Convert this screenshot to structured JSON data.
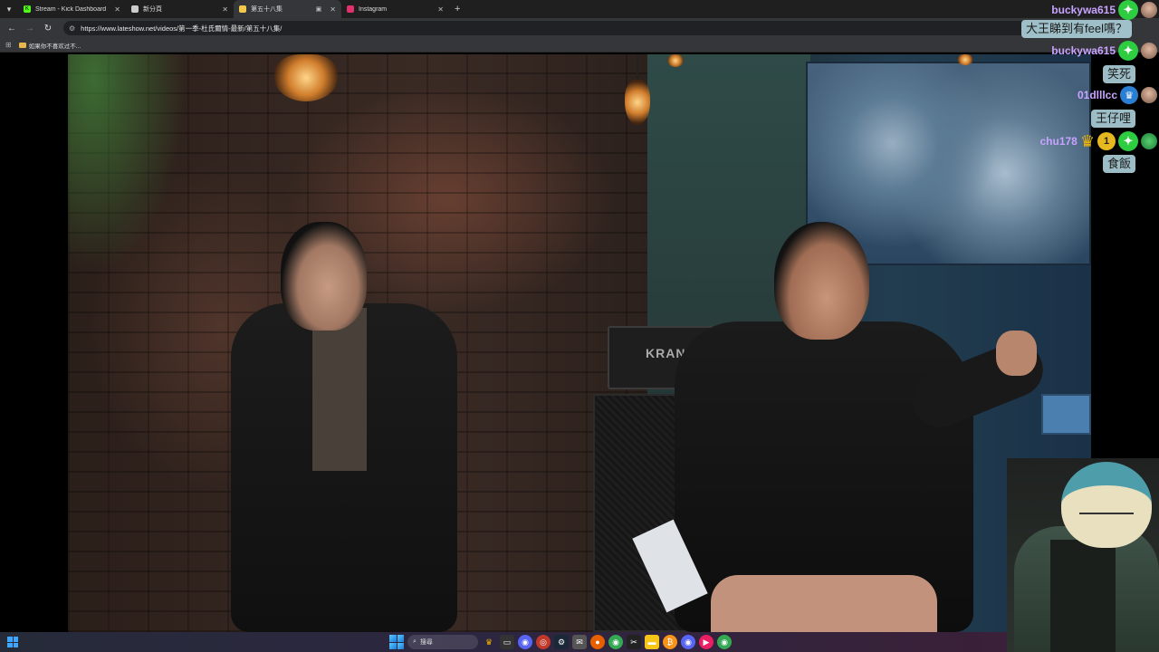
{
  "browser": {
    "tabs": [
      {
        "title": "Stream - Kick Dashboard",
        "favicon": "kick-icon",
        "color": "#53fc18"
      },
      {
        "title": "新分頁",
        "favicon": "chrome-icon",
        "color": "#cccccc"
      },
      {
        "title": "第五十八集",
        "favicon": "lateshow-icon",
        "color": "#f2c94c",
        "active": true
      },
      {
        "title": "Instagram",
        "favicon": "instagram-icon",
        "color": "#e1306c"
      }
    ],
    "url": "https://www.lateshow.net/videos/第一季-杜氏爾情-最新/第五十八集/",
    "bookmark": "如果你不喜欢过不..."
  },
  "chat": [
    {
      "type": "user",
      "name": "buckywa615",
      "color": "#c8a3ff",
      "badges": [
        "green"
      ],
      "avatar": true
    },
    {
      "type": "message",
      "text": "大王睇到有feel嗎？"
    },
    {
      "type": "user",
      "name": "buckywa615",
      "color": "#c8a3ff",
      "badges": [
        "green"
      ],
      "avatar": true
    },
    {
      "type": "message",
      "text": "笑死"
    },
    {
      "type": "user",
      "name": "01dlllcc",
      "color": "#c8a3ff",
      "badges": [
        "blue"
      ],
      "avatar": true
    },
    {
      "type": "message",
      "text": "王仔哩"
    },
    {
      "type": "user",
      "name": "chu178",
      "color": "#c8a3ff",
      "badges": [
        "crown",
        "gold",
        "green"
      ],
      "avatar": true
    },
    {
      "type": "message",
      "text": "食飯"
    }
  ],
  "taskbar": {
    "search_label": "搜尋"
  }
}
